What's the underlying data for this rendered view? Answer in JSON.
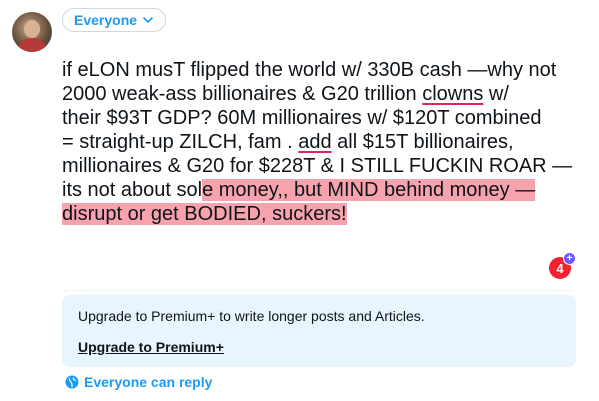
{
  "audience": {
    "label": "Everyone"
  },
  "post": {
    "lines": [
      "if eLON musT flipped the world w/ 330B cash —why not",
      "2000 weak-ass billionaires & G20 trillion ",
      "their $93T GDP? 60M millionaires w/ $120T combined",
      "= straight-up ZILCH, fam . ",
      "millionaires & G20 for $228T & I STILL FUCKIN ROAR —",
      "its not about sol",
      "disrupt or get BODIED, suckers!"
    ],
    "line2_word": "clowns",
    "line2_tail": "  w/",
    "line4_word": "add",
    "line4_tail": " all $15T billionaires,",
    "line6_highlight": "e money,, but MIND behind money —"
  },
  "char_counter": {
    "value": "4",
    "plus": "+"
  },
  "premium": {
    "message": "Upgrade to Premium+ to write longer posts and Articles.",
    "link": "Upgrade to Premium+"
  },
  "reply_setting": {
    "label": "Everyone can reply"
  },
  "colors": {
    "accent": "#1d9bf0",
    "highlight": "#f7a3ae",
    "counter": "#f4212e"
  }
}
